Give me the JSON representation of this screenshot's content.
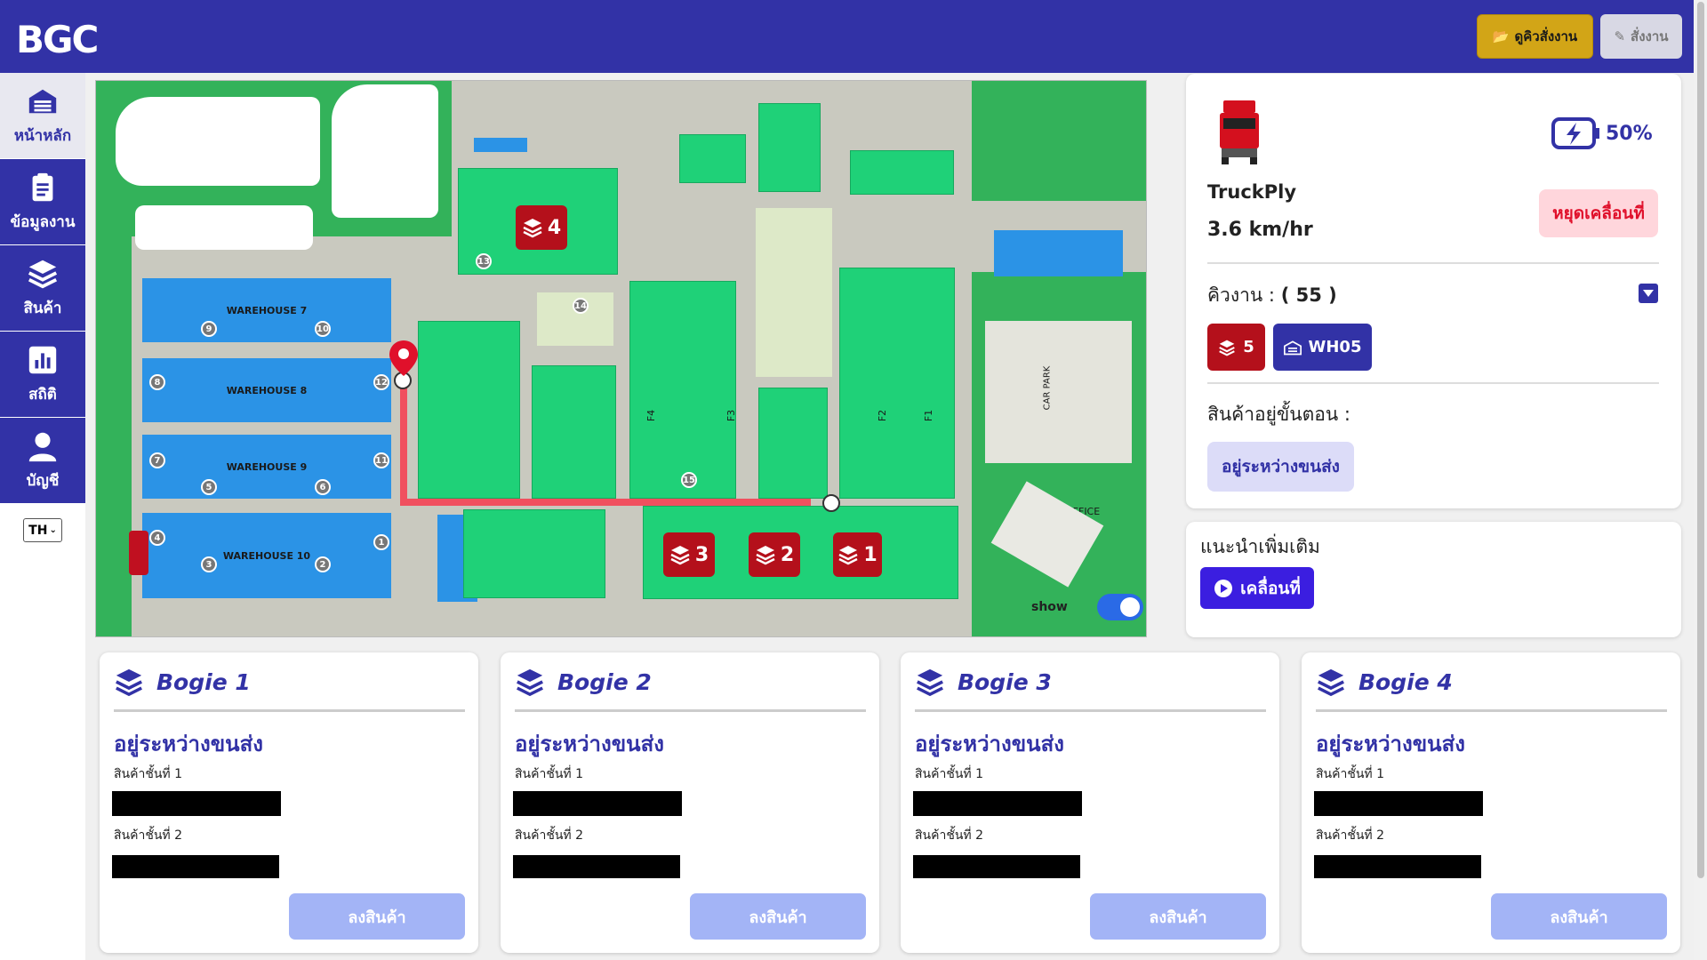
{
  "header": {
    "logo": "BGC",
    "queue_button": "ดูคิวสั่งงาน",
    "order_button": "สั่งงาน"
  },
  "sidebar": {
    "items": [
      {
        "label": "หน้าหลัก",
        "icon": "warehouse-icon"
      },
      {
        "label": "ข้อมูลงาน",
        "icon": "clipboard-icon"
      },
      {
        "label": "สินค้า",
        "icon": "layers-icon"
      },
      {
        "label": "สถิติ",
        "icon": "chart-icon"
      },
      {
        "label": "บัญชี",
        "icon": "user-icon"
      }
    ],
    "language": "TH"
  },
  "map": {
    "warehouses": [
      "WAREHOUSE 7",
      "WAREHOUSE 8",
      "WAREHOUSE 9",
      "WAREHOUSE 10"
    ],
    "markers": [
      "4",
      "3",
      "2",
      "1"
    ],
    "labels": {
      "office": "OFFICE",
      "car_park": "CAR PARK",
      "f1": "F1",
      "f2": "F2",
      "f3": "F3",
      "f4": "F4"
    },
    "show_label": "show",
    "show_toggle_on": true
  },
  "truck": {
    "name": "TruckPly",
    "speed": "3.6 km/hr",
    "battery": "50%",
    "stop_button": "หยุดเคลื่อนที่",
    "queue_label": "คิวงาน :",
    "queue_count": "( 55 )",
    "chip_layers": "5",
    "chip_warehouse": "WH05",
    "step_label": "สินค้าอยู่ขั้นตอน :",
    "step_status": "อยู่ระหว่างขนส่ง"
  },
  "extra": {
    "title": "แนะนำเพิ่มเติม",
    "move_button": "เคลื่อนที่"
  },
  "bogies": [
    {
      "title": "Bogie 1",
      "status": "อยู่ระหว่างขนส่ง",
      "layer1": "สินค้าชั้นที่ 1",
      "layer2": "สินค้าชั้นที่ 2",
      "button": "ลงสินค้า"
    },
    {
      "title": "Bogie 2",
      "status": "อยู่ระหว่างขนส่ง",
      "layer1": "สินค้าชั้นที่ 1",
      "layer2": "สินค้าชั้นที่ 2",
      "button": "ลงสินค้า"
    },
    {
      "title": "Bogie 3",
      "status": "อยู่ระหว่างขนส่ง",
      "layer1": "สินค้าชั้นที่ 1",
      "layer2": "สินค้าชั้นที่ 2",
      "button": "ลงสินค้า"
    },
    {
      "title": "Bogie 4",
      "status": "อยู่ระหว่างขนส่ง",
      "layer1": "สินค้าชั้นที่ 1",
      "layer2": "สินค้าชั้นที่ 2",
      "button": "ลงสินค้า"
    }
  ],
  "colors": {
    "brand": "#3232a6",
    "marker": "#b4101b",
    "route": "#f0505f",
    "stop": "#e0102b"
  }
}
